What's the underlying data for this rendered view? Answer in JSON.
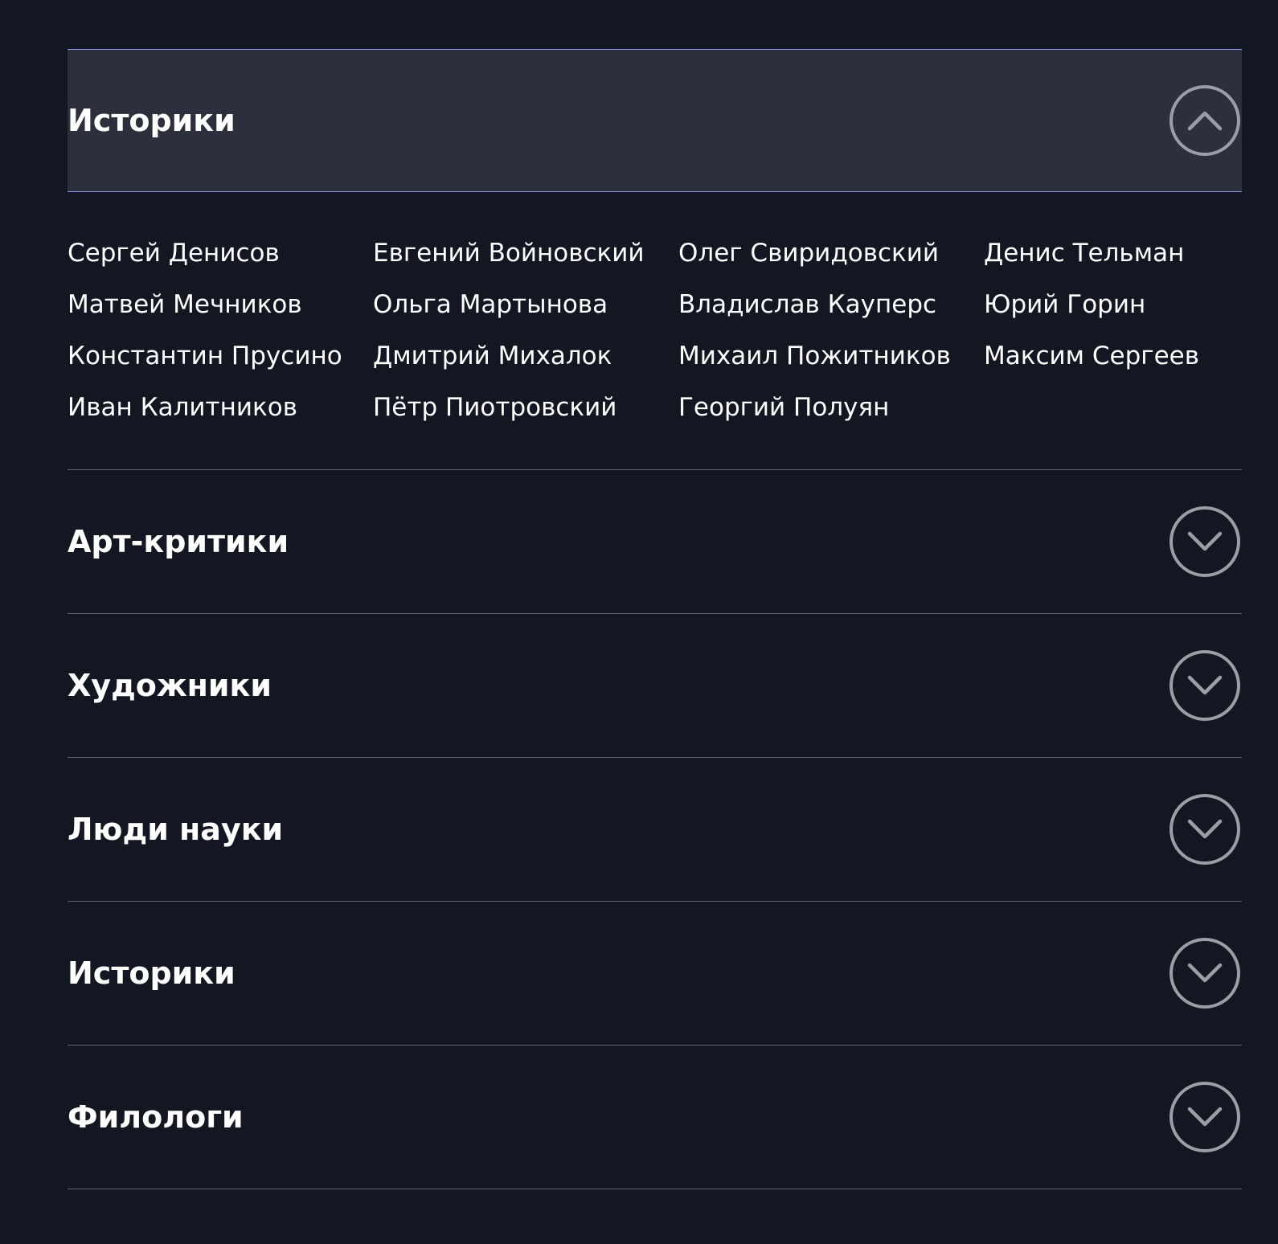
{
  "colors": {
    "background": "#131722",
    "open_header_background": "#2c303c",
    "accent_border": "#8f8ee8",
    "divider": "#5d626e",
    "toggle_stroke": "#9b9ea6",
    "text": "#ffffff"
  },
  "sections": [
    {
      "title": "Историки",
      "expanded": true,
      "toggle_icon": "chevron-up-icon",
      "people": [
        "Сергей Денисов",
        "Евгений Войновский",
        "Олег Свиридовский",
        "Денис Тельман",
        "Матвей Мечников",
        "Ольга Мартынова",
        "Владислав Кауперс",
        "Юрий Горин",
        "Константин Прусино",
        "Дмитрий Михалок",
        "Михаил Пожитников",
        "Максим Сергеев",
        "Иван Калитников",
        "Пётр Пиотровский",
        "Георгий Полуян"
      ]
    },
    {
      "title": "Арт-критики",
      "expanded": false,
      "toggle_icon": "chevron-down-icon"
    },
    {
      "title": "Художники",
      "expanded": false,
      "toggle_icon": "chevron-down-icon"
    },
    {
      "title": "Люди науки",
      "expanded": false,
      "toggle_icon": "chevron-down-icon"
    },
    {
      "title": "Историки",
      "expanded": false,
      "toggle_icon": "chevron-down-icon"
    },
    {
      "title": "Филологи",
      "expanded": false,
      "toggle_icon": "chevron-down-icon"
    }
  ]
}
